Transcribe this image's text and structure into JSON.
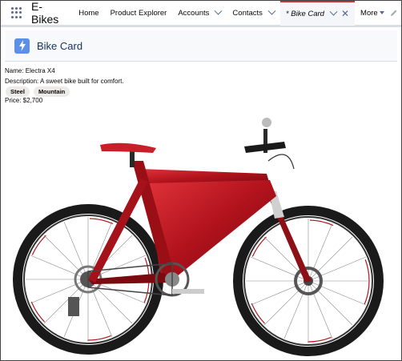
{
  "nav": {
    "app_name": "E-Bikes",
    "items": [
      {
        "label": "Home"
      },
      {
        "label": "Product Explorer"
      },
      {
        "label": "Accounts"
      },
      {
        "label": "Contacts"
      }
    ],
    "active_tab": {
      "label": "* Bike Card"
    },
    "more_label": "More"
  },
  "card": {
    "title": "Bike Card",
    "name_line": "Name: Electra X4",
    "description_line": "Description: A sweet bike built for comfort.",
    "tags": [
      "Steel",
      "Mountain"
    ],
    "price_line": "Price: $2,700"
  },
  "colors": {
    "frame": "#c8202a",
    "accent_tab": "#c23934",
    "icon_bg": "#5c8fe6"
  },
  "icons": {
    "app_launcher": "waffle-icon",
    "card": "lightning-icon",
    "edit": "pencil-icon"
  }
}
